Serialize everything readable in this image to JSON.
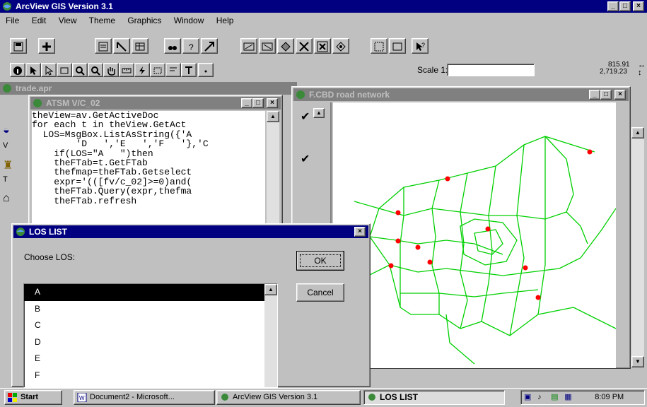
{
  "app": {
    "title": "ArcView GIS Version 3.1",
    "menu": [
      "File",
      "Edit",
      "View",
      "Theme",
      "Graphics",
      "Window",
      "Help"
    ],
    "scale_label": "Scale 1:",
    "scale_value": "",
    "coord_x": "815.91",
    "coord_y": "2,719.23"
  },
  "project_window": {
    "title": "trade.apr"
  },
  "script_window": {
    "title": "ATSM V/C_02",
    "lines": [
      "theView=av.GetActiveDoc",
      "for each t in theView.GetAct",
      "  LOS=MsgBox.ListAsString({'A",
      "        'D   ','E   ','F   '},'C",
      "    if(LOS=\"A   \")then",
      "    theFTab=t.GetFTab",
      "    thefmap=theFTab.Getselect",
      "    expr='(([fv/c_02]>=0)and(",
      "    theFTab.Query(expr,thefma",
      "    theFTab.refresh"
    ]
  },
  "view_window": {
    "title": "F.CBD road network"
  },
  "dialog": {
    "title": "LOS LIST",
    "prompt": "Choose LOS:",
    "ok_label": "OK",
    "cancel_label": "Cancel",
    "items": [
      "A",
      "B",
      "C",
      "D",
      "E",
      "F"
    ],
    "selected": "A"
  },
  "taskbar": {
    "start_label": "Start",
    "tasks": [
      "Document2 - Microsoft...",
      "ArcView GIS Version 3.1",
      "LOS LIST"
    ],
    "clock": "8:09 PM"
  },
  "colors": {
    "titlebar_active": "#000080",
    "road": "#00d000",
    "point": "#ff0000"
  }
}
